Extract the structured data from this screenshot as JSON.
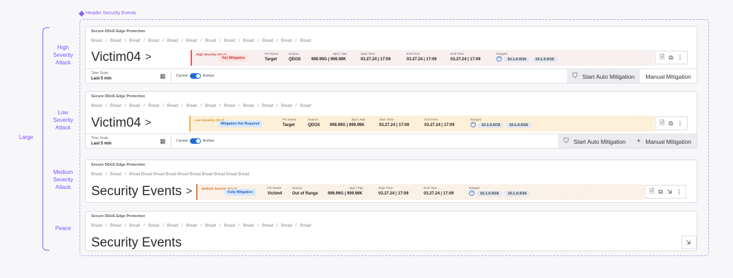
{
  "frame_title": "Header Security Events",
  "side_group_label": "Large",
  "crumb_separator": "/",
  "icons": {
    "calendar": "calendar-icon",
    "doc": "document-icon",
    "copy": "copy-icon",
    "export": "export-icon",
    "kebab": "kebab-icon",
    "shield": "shield-icon",
    "plus": "plus-icon",
    "chevron": "chevron-right-icon"
  },
  "colors": {
    "accent": "#8a5cf6",
    "high": "#e05a5a",
    "low": "#e8b24a",
    "medium": "#e07a3a",
    "toggle": "#1f6fd1"
  },
  "variants": [
    {
      "side_label": "High Severity Attack",
      "card_title": "Secure DDoS Edge Protection",
      "crumbs": [
        "Bread",
        "Bread",
        "Bread",
        "Bread",
        "Bread",
        "Bread",
        "Bread",
        "Bread",
        "Bread",
        "Bread",
        "Bread",
        "Bread"
      ],
      "title": "Victim04",
      "chevron": ">",
      "severity": "High Severity Attack",
      "chip": "Not Mitigation",
      "cols": [
        {
          "h": "PO Name",
          "v": "Target"
        },
        {
          "h": "Source",
          "v": "QDOS"
        },
        {
          "h": "Bps | Pps",
          "v": "999.99G | 999.99K"
        },
        {
          "h": "Start Time",
          "v": "03.27.24 | 17:09"
        },
        {
          "h": "End Time",
          "v": "03.27.24 | 17:09"
        },
        {
          "h": "End Time",
          "v": "03.27.24 | 17:09"
        }
      ],
      "ranges_label": "Ranges",
      "ranges": [
        "10.1.0.0/16",
        "10.1.0.0/16"
      ],
      "time_scale_label": "Time Scale",
      "time_scale_value": "Last 5 min",
      "toggle_current": "Current",
      "toggle_archive": "Archive",
      "start_auto": "Start Auto Mitigation",
      "manual": "Manual Mitigation"
    },
    {
      "side_label": "Low Severity Attack",
      "card_title": "Secure DDoS Edge Protection",
      "crumbs": [
        "Bread",
        "Bread",
        "Bread",
        "Bread",
        "Bread",
        "Bread",
        "Bread",
        "Bread",
        "Bread",
        "Bread",
        "Bread",
        "Bread"
      ],
      "title": "Victim04",
      "chevron": ">",
      "severity": "Low Severity Attack",
      "chip": "Mitigation Not Required",
      "cols": [
        {
          "h": "PO Name",
          "v": "Target"
        },
        {
          "h": "Source",
          "v": "QDOS"
        },
        {
          "h": "Bps | Pps",
          "v": "999.99G | 999.99K"
        },
        {
          "h": "Start Time",
          "v": "03.27.24 | 17:09"
        },
        {
          "h": "End Time",
          "v": "03.27.24 | 17:09"
        }
      ],
      "ranges_label": "Ranges",
      "ranges": [
        "10.1.0.0/16",
        "10.1.0.0/16"
      ],
      "time_scale_label": "Time Scale",
      "time_scale_value": "Last 5 min",
      "toggle_current": "Current",
      "toggle_archive": "Archive",
      "start_auto": "Start Auto Mitigation",
      "manual": "Manual Mitigation"
    },
    {
      "side_label": "Medium Severity Attack",
      "card_title": "Secure DDoS Edge Protection",
      "crumbs": [
        "Bread",
        "Bread",
        "Bread Bread Bread Bread Bread Bread Bread Bread Bread Bread"
      ],
      "title": "Security Events",
      "chevron": ">",
      "severity": "Medium Severity Attack",
      "chip": "Fully Mitigation",
      "cols": [
        {
          "h": "PO Name",
          "v": "Victim4"
        },
        {
          "h": "Source",
          "v": "Out of Range"
        },
        {
          "h": "Bps | Pps",
          "v": "999.99G | 999.99K"
        },
        {
          "h": "Start Time",
          "v": "03.27.24 | 17:09"
        },
        {
          "h": "End Time",
          "v": "03.27.24 | 17:09"
        }
      ],
      "ranges_label": "Ranges",
      "ranges": [
        "10.1.0.0/16",
        "10.1.0.0/16"
      ]
    },
    {
      "side_label": "Peace",
      "card_title": "Secure DDoS Edge Protection",
      "crumbs": [
        "Bread",
        "Bread",
        "Bread",
        "Bread",
        "Bread",
        "Bread",
        "Bread",
        "Bread",
        "Bread",
        "Bread",
        "Bread",
        "Bread"
      ],
      "title": "Security Events"
    }
  ]
}
